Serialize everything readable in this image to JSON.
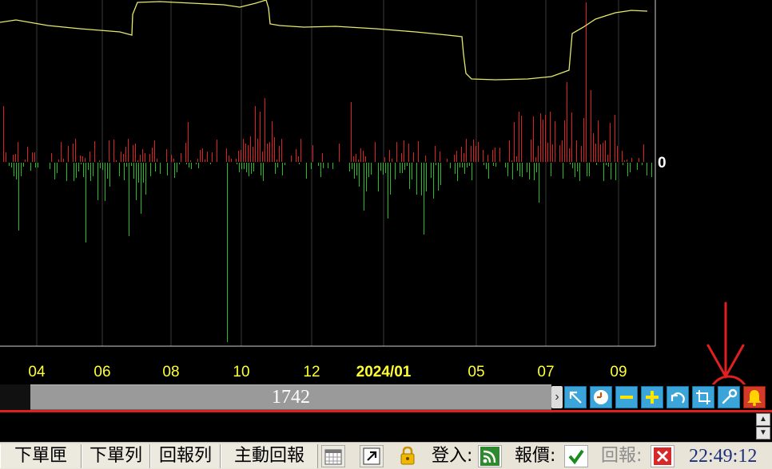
{
  "chart_data": {
    "type": "bar",
    "zero_label": "0",
    "x_ticks": [
      "04",
      "06",
      "08",
      "10",
      "12",
      "2024/01",
      "05",
      "07",
      "09"
    ],
    "bold_tick": "2024/01",
    "colors": {
      "positive": "#e02020",
      "negative": "#22c022",
      "line": "#e8e86a",
      "grid": "#3a3a3a",
      "tick": "#ffff33"
    }
  },
  "scrollbar": {
    "value": "1742"
  },
  "toolbar": {
    "buttons": [
      "arrow-up-left-icon",
      "clock-icon",
      "minus-icon",
      "plus-icon",
      "undo-icon",
      "crop-icon",
      "wrench-icon",
      "bell-icon"
    ]
  },
  "command": {
    "value": ""
  },
  "status": {
    "order_box": "下單匣",
    "order_list": "下單列",
    "report_list": "回報列",
    "active_report": "主動回報",
    "login_label": "登入:",
    "quote_label": "報價:",
    "report_label": "回報:",
    "time": "22:49:12"
  },
  "annotation": {
    "color": "#e02020"
  }
}
